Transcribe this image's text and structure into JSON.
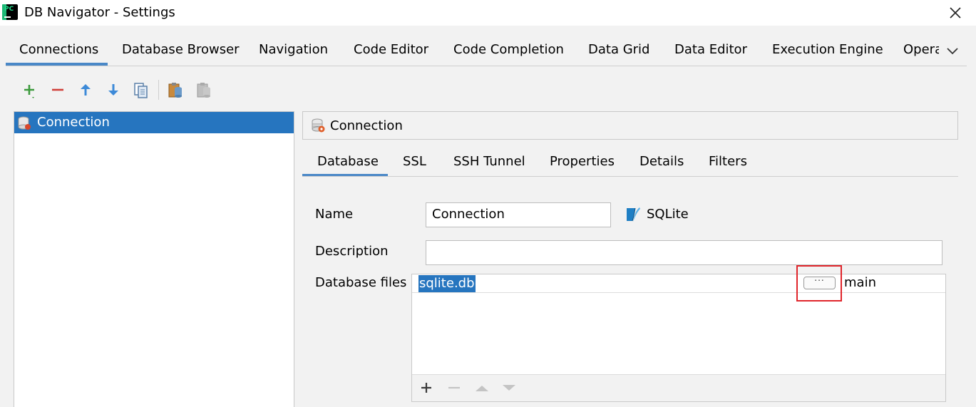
{
  "window": {
    "title": "DB Navigator - Settings",
    "app_logo": "pycharm-logo",
    "close_icon": "close-icon"
  },
  "main_tabs": [
    {
      "label": "Connections",
      "active": true
    },
    {
      "label": "Database Browser"
    },
    {
      "label": "Navigation"
    },
    {
      "label": "Code Editor"
    },
    {
      "label": "Code Completion"
    },
    {
      "label": "Data Grid"
    },
    {
      "label": "Data Editor"
    },
    {
      "label": "Execution Engine"
    },
    {
      "label": "Opera"
    }
  ],
  "toolbar": {
    "icons": [
      "add-icon",
      "remove-icon",
      "move-up-icon",
      "move-down-icon",
      "copy-icon",
      "paste-icon",
      "duplicate-icon"
    ]
  },
  "connections": {
    "items": [
      {
        "label": "Connection",
        "selected": true
      }
    ]
  },
  "detail": {
    "header": "Connection",
    "sub_tabs": [
      {
        "label": "Database",
        "active": true
      },
      {
        "label": "SSL"
      },
      {
        "label": "SSH Tunnel"
      },
      {
        "label": "Properties"
      },
      {
        "label": "Details"
      },
      {
        "label": "Filters"
      }
    ],
    "form": {
      "name_label": "Name",
      "name_value": "Connection",
      "db_type": "SQLite",
      "description_label": "Description",
      "description_value": "",
      "files_label": "Database files",
      "files": [
        {
          "path": "sqlite.db",
          "schema": "main"
        }
      ],
      "browse_label": "..."
    },
    "files_toolbar": [
      "add-icon",
      "remove-icon",
      "move-up-icon",
      "move-down-icon"
    ]
  },
  "colors": {
    "accent": "#2675bf",
    "tab_underline": "#4a88c7",
    "highlight": "#e0252b"
  }
}
